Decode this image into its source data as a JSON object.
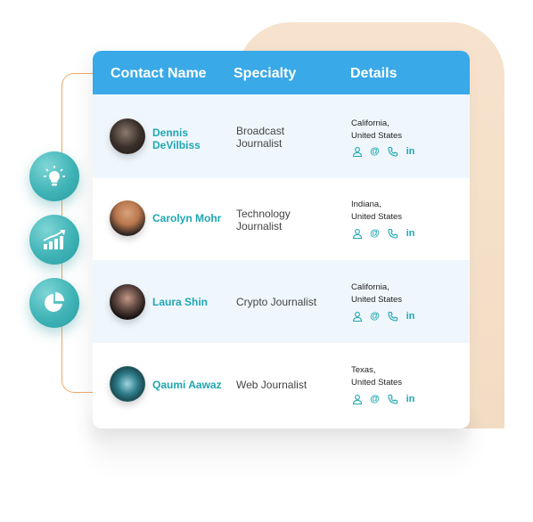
{
  "table": {
    "headers": [
      "Contact Name",
      "Specialty",
      "Details"
    ],
    "rows": [
      {
        "name_line1": "Dennis",
        "name_line2": "DeVilbiss",
        "specialty_line1": "Broadcast",
        "specialty_line2": "Journalist",
        "location_line1": "California,",
        "location_line2": "United States",
        "avatar": "man-photo"
      },
      {
        "name_line1": "Carolyn Mohr",
        "name_line2": "",
        "specialty_line1": "Technology",
        "specialty_line2": "Journalist",
        "location_line1": "Indiana,",
        "location_line2": "United States",
        "avatar": "woman-blonde-photo"
      },
      {
        "name_line1": "Laura Shin",
        "name_line2": "",
        "specialty_line1": "Crypto Journalist",
        "specialty_line2": "",
        "location_line1": "California,",
        "location_line2": "United States",
        "avatar": "woman-dark-hair-photo"
      },
      {
        "name_line1": "Qaumi Aawaz",
        "name_line2": "",
        "specialty_line1": "Web Journalist",
        "specialty_line2": "",
        "location_line1": "Texas,",
        "location_line2": "United States",
        "avatar": "logo-circle"
      }
    ],
    "detail_icons": {
      "profile": "user-icon",
      "email": "@",
      "phone": "phone-icon",
      "linkedin": "in"
    }
  },
  "side_icons": [
    "lightbulb-icon",
    "growth-chart-icon",
    "pie-chart-icon"
  ],
  "colors": {
    "header": "#3aa9e8",
    "accent": "#1fa6b0",
    "peach": "#f6e2cd",
    "bracket": "#f0a868"
  }
}
